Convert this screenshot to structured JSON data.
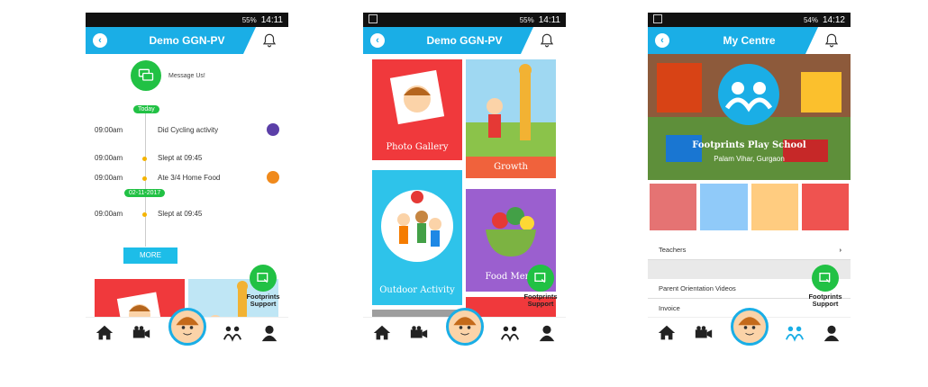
{
  "phones": [
    {
      "status": {
        "battery": "55%",
        "time": "14:11"
      },
      "title": "Demo GGN-PV",
      "message_label": "Message Us!",
      "timeline": {
        "badge_today": "Today",
        "items": [
          {
            "time": "09:00am",
            "text": "Did Cycling activity"
          },
          {
            "time": "09:00am",
            "text": "Slept at 09:45"
          },
          {
            "time": "09:00am",
            "text": "Ate 3/4 Home Food"
          }
        ],
        "badge_date": "02-11-2017",
        "items2": [
          {
            "time": "09:00am",
            "text": "Slept at 09:45"
          }
        ],
        "more_label": "MORE"
      },
      "support_label": "Footprints Support"
    },
    {
      "status": {
        "battery": "55%",
        "time": "14:11"
      },
      "title": "Demo GGN-PV",
      "tiles": {
        "photo_gallery": "Photo Gallery",
        "growth": "Growth",
        "outdoor_activity": "Outdoor Activity",
        "food_menu": "Food Menu"
      },
      "support_label": "Footprints Support"
    },
    {
      "status": {
        "battery": "54%",
        "time": "14:12"
      },
      "title": "My Centre",
      "school_name": "Footprints Play School",
      "school_location": "Palam Vihar, Gurgaon",
      "list": {
        "teachers": "Teachers",
        "parent_orientation": "Parent Orientation Videos",
        "invoice": "Invoice"
      },
      "support_label": "Footprints Support"
    }
  ],
  "colors": {
    "accent": "#1aaee6",
    "green": "#21c144",
    "red": "#f0393c",
    "purple": "#9b5fcf",
    "teal": "#2ec3ea"
  }
}
